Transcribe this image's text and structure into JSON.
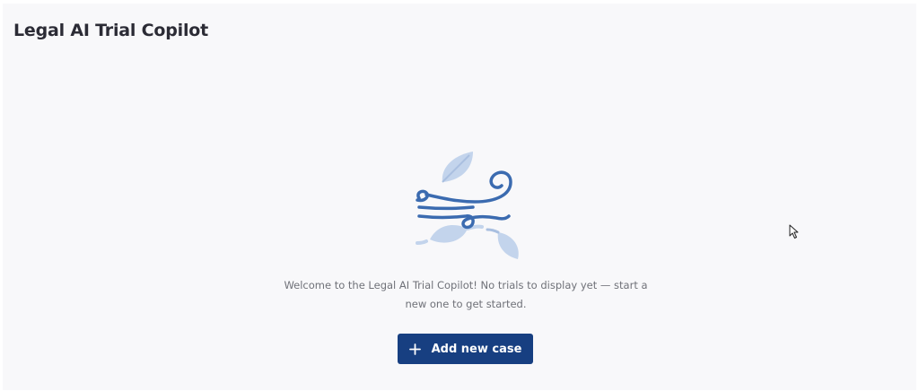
{
  "app": {
    "title": "Legal AI Trial Copilot"
  },
  "empty_state": {
    "illustration_icon": "wind-leaves-icon",
    "message": "Welcome to the Legal AI Trial Copilot! No trials to display yet — start a new one to get started.",
    "add_button_label": "Add new case",
    "add_button_icon": "plus-icon"
  },
  "colors": {
    "background": "#f8f8fa",
    "title_text": "#2b2b35",
    "body_text": "#6f7178",
    "primary_button": "#173f81",
    "illustration_stroke": "#3b6bb0",
    "illustration_leaf": "#c3d4ec"
  }
}
